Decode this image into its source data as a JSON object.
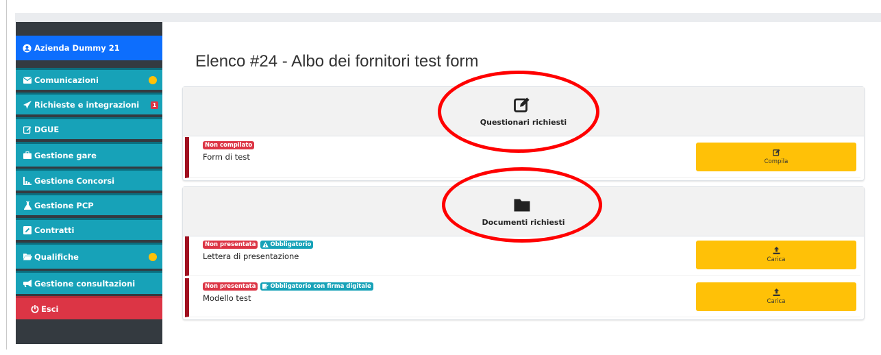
{
  "sidebar": {
    "company": "Azienda Dummy 21",
    "items": [
      {
        "label": "Comunicazioni",
        "icon": "envelope-icon"
      },
      {
        "label": "Richieste e integrazioni",
        "icon": "paper-plane-icon",
        "badge": "1"
      },
      {
        "label": "DGUE",
        "icon": "edit-icon"
      },
      {
        "label": "Gestione gare",
        "icon": "briefcase-icon"
      },
      {
        "label": "Gestione Concorsi",
        "icon": "podium-icon"
      },
      {
        "label": "Gestione PCP",
        "icon": "flask-icon"
      },
      {
        "label": "Contratti",
        "icon": "pen-square-icon"
      },
      {
        "label": "Qualifiche",
        "icon": "folder-open-icon"
      },
      {
        "label": "Gestione consultazioni",
        "icon": "megaphone-icon"
      }
    ],
    "exit": "Esci"
  },
  "page": {
    "title": "Elenco #24 - Albo dei fornitori test form"
  },
  "questionari": {
    "header": "Questionari richiesti",
    "rows": [
      {
        "badges": [
          "Non compilato"
        ],
        "text": "Form di test",
        "action": "Compila"
      }
    ]
  },
  "documenti": {
    "header": "Documenti richiesti",
    "rows": [
      {
        "badges": [
          "Non presentata",
          "Obbligatorio"
        ],
        "text": "Lettera di presentazione",
        "action": "Carica"
      },
      {
        "badges": [
          "Non presentata",
          "Obbligatorio con firma digitale"
        ],
        "text": "Modello test",
        "action": "Carica"
      }
    ]
  },
  "colors": {
    "sidebar_bg": "#343a40",
    "company_bg": "#0d6efd",
    "menu_bg": "#17a2b8",
    "exit_bg": "#dc3545",
    "action_bg": "#ffc107",
    "badge_red": "#dc3545",
    "badge_teal": "#17a2b8",
    "row_accent": "#a01020",
    "annotation": "#ff0000"
  }
}
